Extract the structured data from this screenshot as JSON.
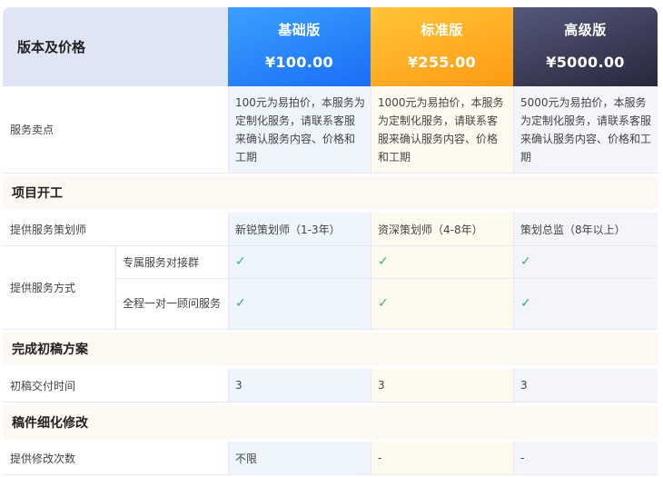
{
  "header": {
    "label": "版本及价格",
    "plans": [
      {
        "name": "基础版",
        "price": "¥100.00"
      },
      {
        "name": "标准版",
        "price": "¥255.00"
      },
      {
        "name": "高级版",
        "price": "¥5000.00"
      }
    ]
  },
  "selling_point": {
    "label": "服务卖点",
    "values": [
      "100元为易拍价，本服务为定制化服务，请联系客服来确认服务内容、价格和工期",
      "1000元为易拍价，本服务为定制化服务，请联系客服来确认服务内容、价格和工期",
      "5000元为易拍价，本服务为定制化服务，请联系客服来确认服务内容、价格和工期"
    ]
  },
  "sections": {
    "kickoff": {
      "title": "项目开工",
      "planner": {
        "label": "提供服务策划师",
        "values": [
          "新锐策划师（1-3年）",
          "资深策划师（4-8年）",
          "策划总监（8年以上）"
        ]
      },
      "method": {
        "label": "提供服务方式",
        "sub1": {
          "label": "专属服务对接群",
          "values": [
            "✓",
            "✓",
            "✓"
          ]
        },
        "sub2": {
          "label": "全程一对一顾问服务",
          "values": [
            "✓",
            "✓",
            "✓"
          ]
        }
      }
    },
    "draft": {
      "title": "完成初稿方案",
      "delivery": {
        "label": "初稿交付时间",
        "values": [
          "3",
          "3",
          "3"
        ]
      }
    },
    "refine": {
      "title": "稿件细化修改",
      "revisions": {
        "label": "提供修改次数",
        "values": [
          "不限",
          "-",
          "-"
        ]
      }
    }
  },
  "colors": {
    "basic": "#1a6ef5",
    "standard": "#ff9a14",
    "premium": "#27283c",
    "check": "#2bb273"
  }
}
